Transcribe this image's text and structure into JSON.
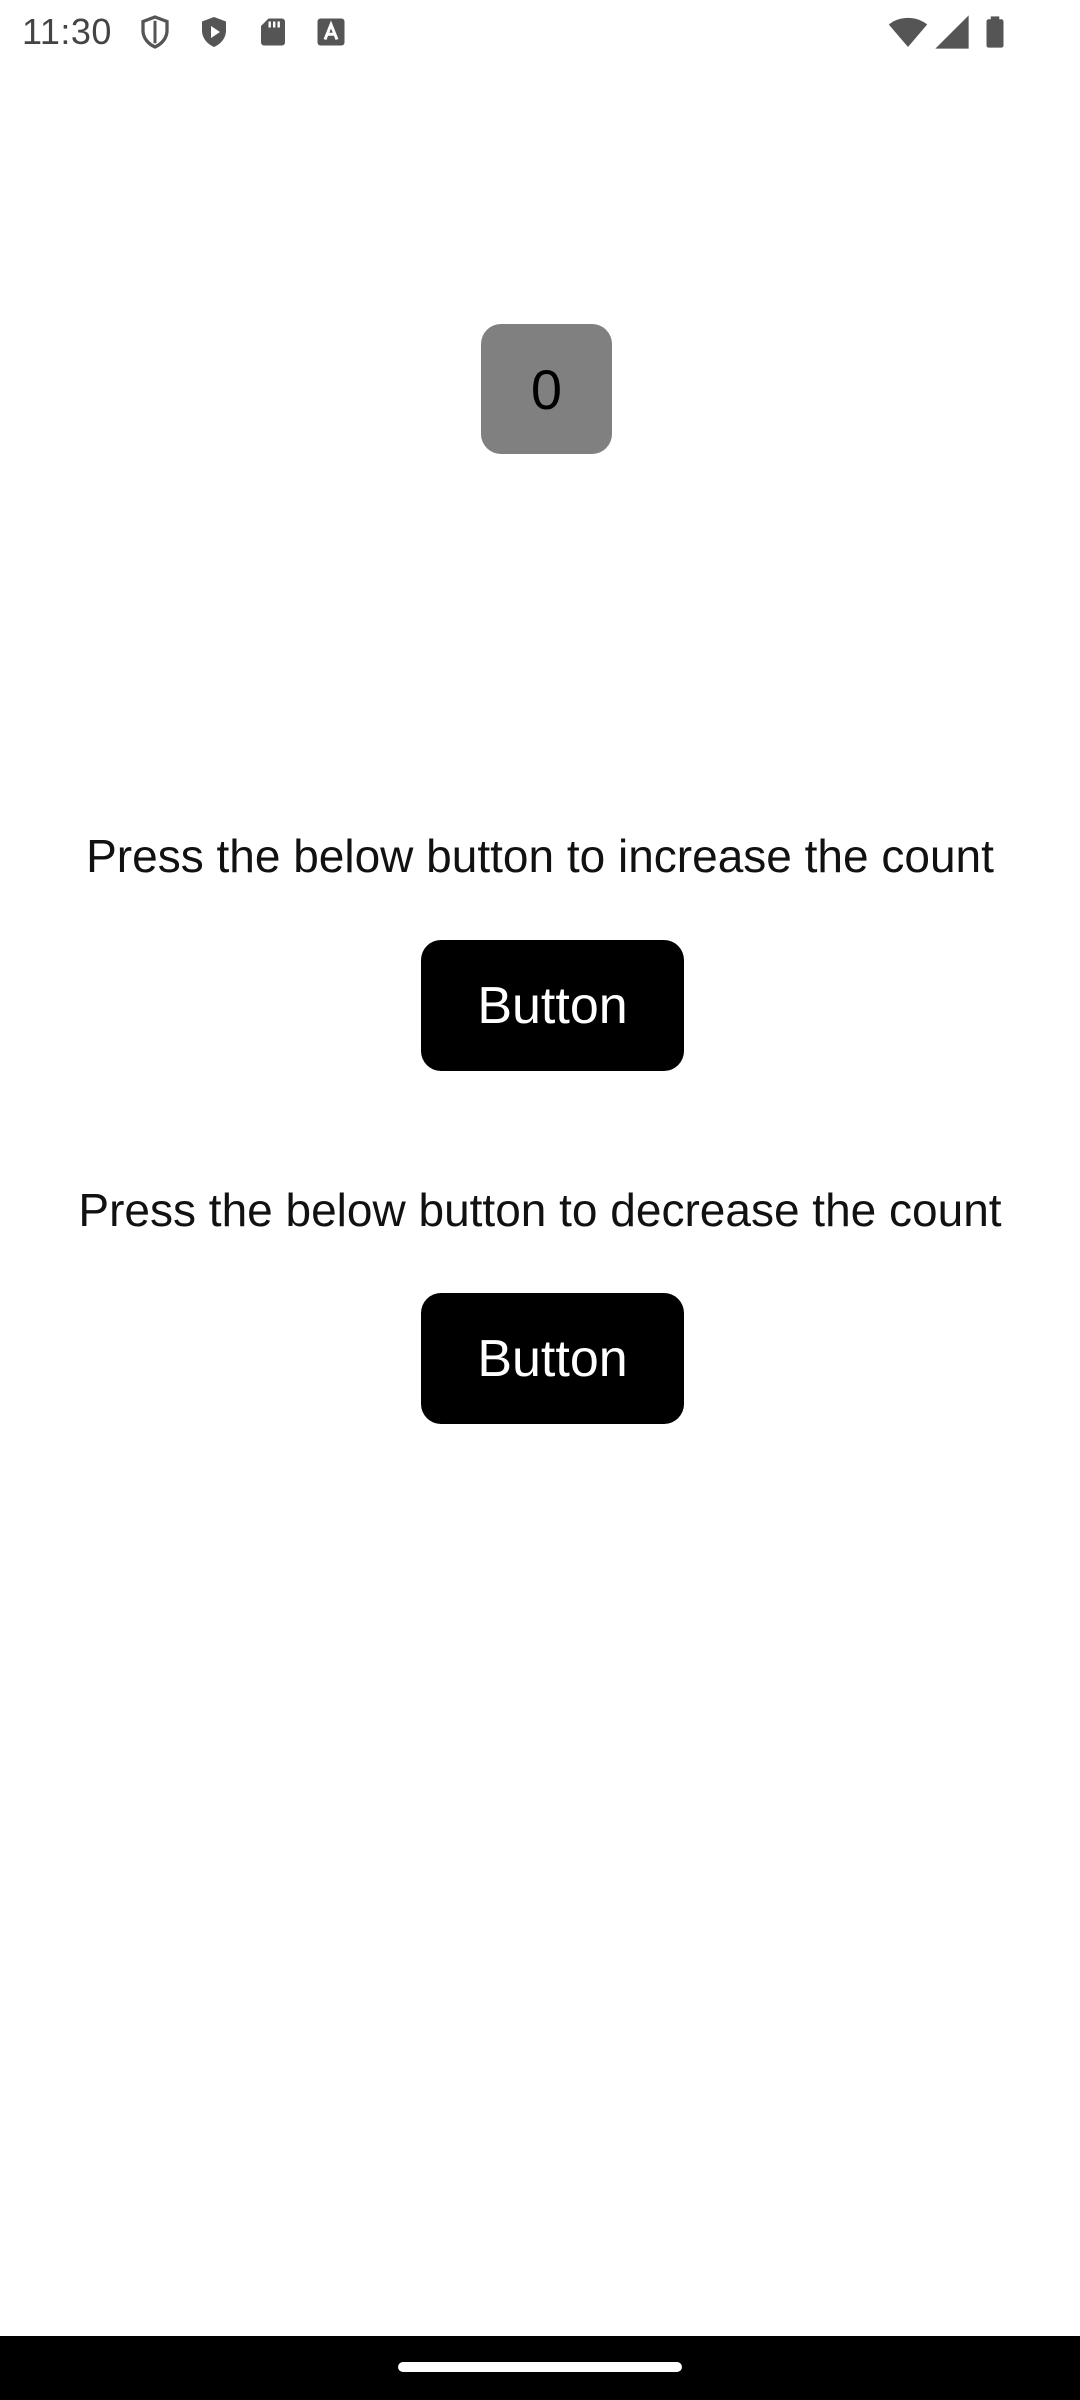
{
  "status_bar": {
    "time": "11:30",
    "icons_left": [
      "shield-icon",
      "play-shield-icon",
      "sd-card-icon",
      "font-a-icon"
    ],
    "icons_right": [
      "wifi-icon",
      "cellular-signal-icon",
      "battery-icon"
    ]
  },
  "counter": {
    "value": "0",
    "box_color": "#808080"
  },
  "increase_section": {
    "instruction": "Press the below button to increase the count",
    "button_label": "Button"
  },
  "decrease_section": {
    "instruction": "Press the below button to decrease the count",
    "button_label": "Button"
  },
  "colors": {
    "button_background": "#000000",
    "button_text": "#ffffff",
    "page_background": "#ffffff",
    "navigation_bar": "#000000"
  }
}
